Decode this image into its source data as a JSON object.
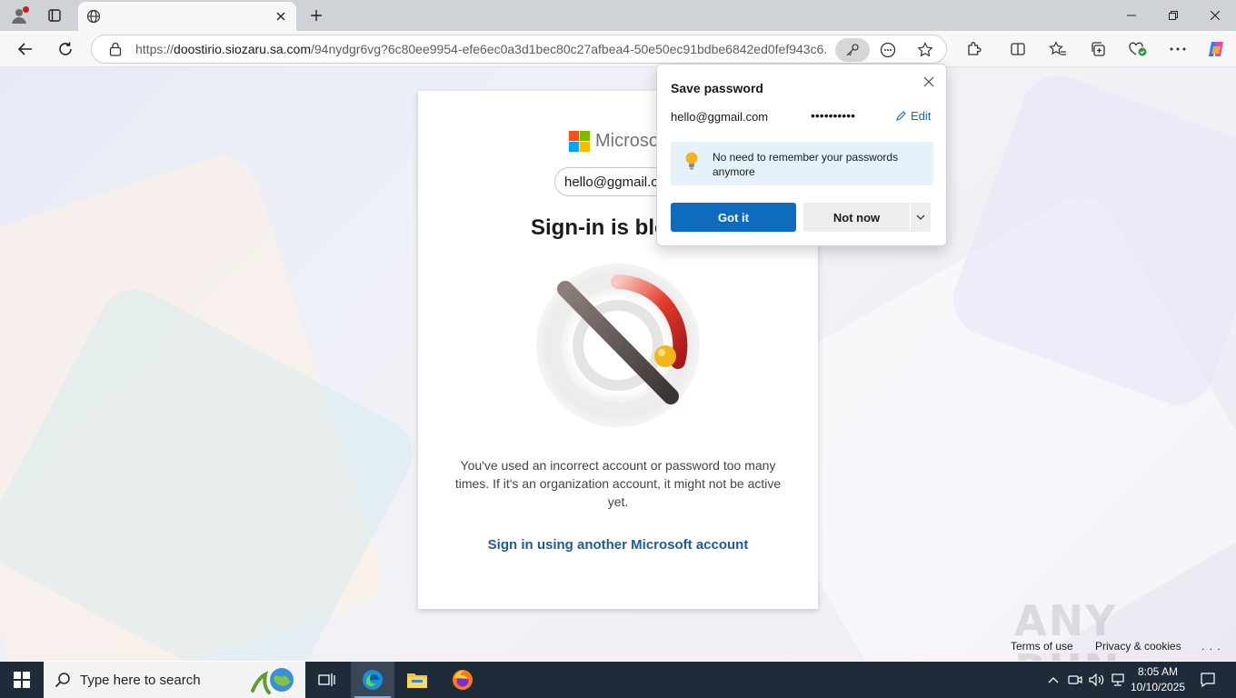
{
  "browser": {
    "tab_title": "",
    "url_prefix": "https://",
    "url_domain": "doostirio.siozaru.sa.com",
    "url_rest": "/94nydgr6vg?6c80ee9954-efe6ec0a3d1bec80c27afbea4-50e50ec91bdbe6842ed0fef943c6..."
  },
  "signin": {
    "brand": "Microsoft",
    "identity": "hello@ggmail.com",
    "title": "Sign-in is blocked",
    "description": "You've used an incorrect account or password too many times. If it's an organization account, it might not be active yet.",
    "alt_link": "Sign in using another Microsoft account",
    "footer_terms": "Terms of use",
    "footer_privacy": "Privacy & cookies",
    "footer_more": ". . ."
  },
  "save_password": {
    "title": "Save password",
    "username": "hello@ggmail.com",
    "password_mask": "••••••••••",
    "edit_label": "Edit",
    "tip": "No need to remember your passwords anymore",
    "primary_button": "Got it",
    "secondary_button": "Not now"
  },
  "taskbar": {
    "search_placeholder": "Type here to search",
    "time": "8:05 AM",
    "date": "10/10/2025"
  },
  "watermark": "ANY RUN",
  "colors": {
    "accent": "#0f6cbd",
    "link": "#1e5b9a",
    "taskbar": "#1f2b38",
    "ms_red": "#f25022",
    "ms_green": "#7fba00",
    "ms_blue": "#00a4ef",
    "ms_yellow": "#ffb900"
  },
  "icons": [
    "profile-icon",
    "tab-actions-icon",
    "globe-icon",
    "close-icon",
    "plus-icon",
    "minimize-icon",
    "restore-icon",
    "back-icon",
    "refresh-icon",
    "lock-icon",
    "key-icon",
    "emoji-icon",
    "star-icon",
    "extensions-icon",
    "split-screen-icon",
    "favorites-icon",
    "collections-icon",
    "performance-icon",
    "more-icon",
    "copilot-icon",
    "pencil-icon",
    "lightbulb-icon",
    "chevron-down-icon",
    "windows-icon",
    "search-icon",
    "task-view-icon",
    "edge-icon",
    "file-explorer-icon",
    "firefox-icon"
  ]
}
